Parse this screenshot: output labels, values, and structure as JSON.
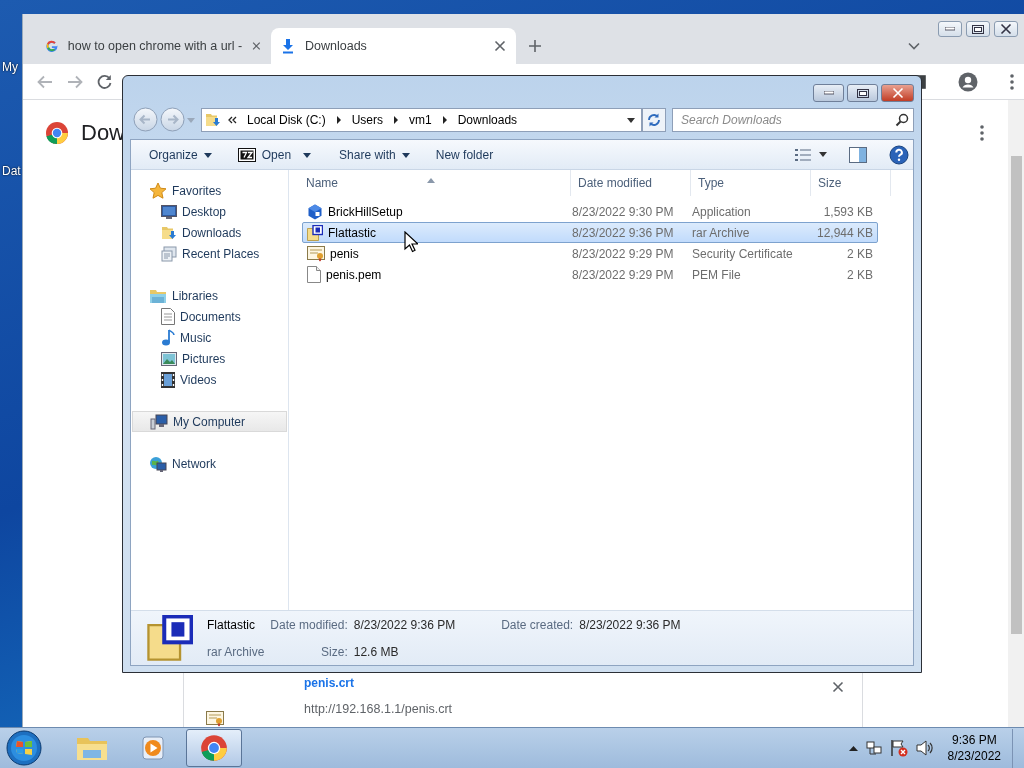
{
  "desktop": {
    "icons": [
      {
        "label": "My"
      },
      {
        "label": "Dat"
      }
    ]
  },
  "browser": {
    "tabs": [
      {
        "title": "how to open chrome with a url -",
        "kind": "google",
        "selected": false
      },
      {
        "title": "Downloads",
        "kind": "download",
        "selected": true
      }
    ],
    "page": {
      "heading": "Dow"
    },
    "download": {
      "name": "penis.crt",
      "url": "http://192.168.1.1/penis.crt"
    }
  },
  "explorer": {
    "breadcrumb": [
      "Local Disk (C:)",
      "Users",
      "vm1",
      "Downloads"
    ],
    "search": {
      "placeholder": "Search Downloads"
    },
    "toolbar": [
      {
        "label": "Organize",
        "kind": "menu"
      },
      {
        "label": "Open",
        "kind": "archive"
      },
      {
        "label": "Share with",
        "kind": "menu"
      },
      {
        "label": "New folder",
        "kind": "plain"
      }
    ],
    "nav": [
      {
        "label": "Favorites",
        "kind": "star",
        "selected": false,
        "children": [
          {
            "label": "Desktop",
            "kind": "desktop",
            "selected": false
          },
          {
            "label": "Downloads",
            "kind": "downloads",
            "selected": false
          },
          {
            "label": "Recent Places",
            "kind": "recent",
            "selected": false
          }
        ]
      },
      {
        "label": "Libraries",
        "kind": "libraries",
        "selected": false,
        "children": [
          {
            "label": "Documents",
            "kind": "document",
            "selected": false
          },
          {
            "label": "Music",
            "kind": "music",
            "selected": false
          },
          {
            "label": "Pictures",
            "kind": "pictures",
            "selected": false
          },
          {
            "label": "Videos",
            "kind": "videos",
            "selected": false
          }
        ]
      },
      {
        "label": "My Computer",
        "kind": "computer",
        "selected": true
      },
      {
        "label": "Network",
        "kind": "network",
        "selected": false
      }
    ],
    "columns": [
      "Name",
      "Date modified",
      "Type",
      "Size"
    ],
    "files": [
      {
        "name": "BrickHillSetup",
        "date": "8/23/2022 9:30 PM",
        "type": "Application",
        "size": "1,593 KB",
        "kind": "app",
        "selected": false
      },
      {
        "name": "Flattastic",
        "date": "8/23/2022 9:36 PM",
        "type": "rar Archive",
        "size": "12,944 KB",
        "kind": "rar",
        "selected": true
      },
      {
        "name": "penis",
        "date": "8/23/2022 9:29 PM",
        "type": "Security Certificate",
        "size": "2 KB",
        "kind": "cert",
        "selected": false
      },
      {
        "name": "penis.pem",
        "date": "8/23/2022 9:29 PM",
        "type": "PEM File",
        "size": "2 KB",
        "kind": "blank",
        "selected": false
      }
    ],
    "details": {
      "name": "Flattastic",
      "type": "rar Archive",
      "fields": [
        {
          "label": "Date modified:",
          "value": "8/23/2022 9:36 PM"
        },
        {
          "label": "Date created:",
          "value": "8/23/2022 9:36 PM"
        },
        {
          "label": "Size:",
          "value": "12.6 MB"
        }
      ]
    }
  },
  "taskbar": {
    "apps": [
      {
        "kind": "explorer",
        "selected": false
      },
      {
        "kind": "media",
        "selected": false
      },
      {
        "kind": "chrome",
        "selected": true
      }
    ],
    "time": "9:36 PM",
    "date": "8/23/2022"
  }
}
